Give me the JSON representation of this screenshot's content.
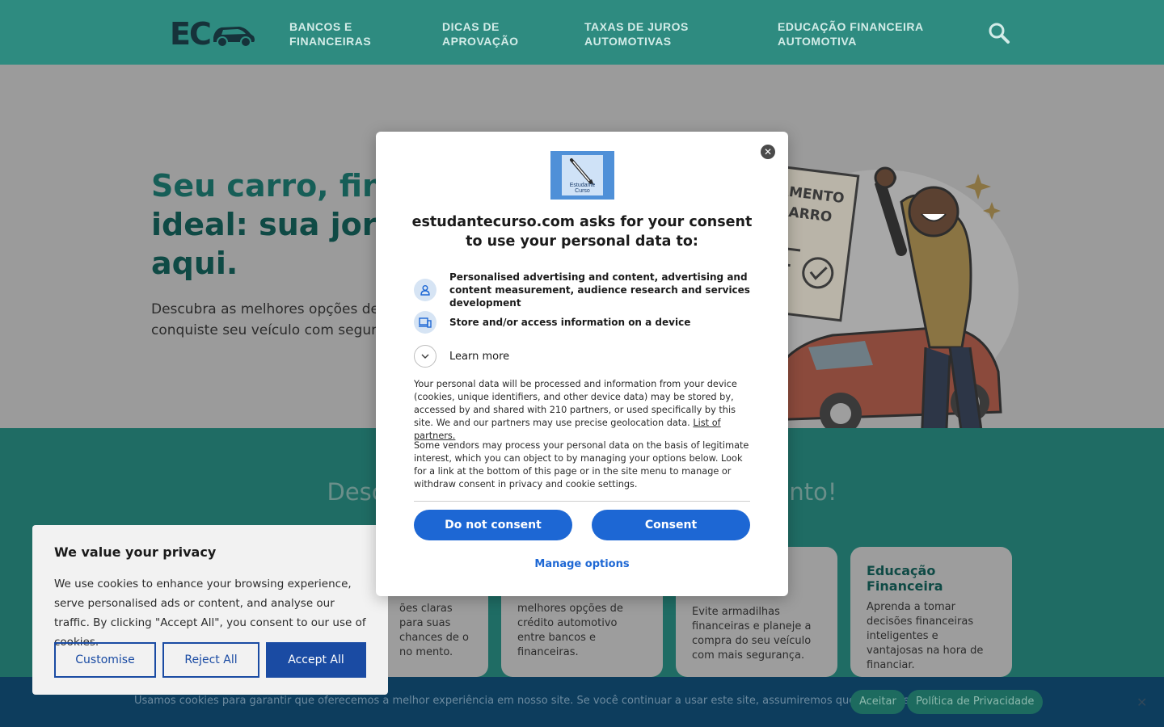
{
  "header": {
    "logo_text": "EC",
    "nav": [
      {
        "label": "BANCOS E FINANCEIRAS"
      },
      {
        "label": "DICAS DE APROVAÇÃO"
      },
      {
        "label": "TAXAS DE JUROS AUTOMOTIVAS"
      },
      {
        "label": "EDUCAÇÃO FINANCEIRA AUTOMOTIVA"
      }
    ]
  },
  "hero": {
    "title_line1": "Seu carro, financ",
    "title_line2": "ideal: sua jornad",
    "title_line3": "aqui.",
    "desc_line1": "Descubra as melhores opções de",
    "desc_line2": "conquiste seu veículo com segur",
    "illustration_text_line1": "NAMENTO",
    "illustration_text_line2": "ARRO"
  },
  "section": {
    "title_left": "Descub",
    "title_right": "amento!",
    "cards": [
      {
        "title": "",
        "text": "ões claras para suas chances de o no mento."
      },
      {
        "title": "",
        "text": "melhores opções de crédito automotivo entre bancos e financeiras."
      },
      {
        "title": "",
        "text": "Evite armadilhas financeiras e planeje a compra do seu veículo com mais segurança."
      },
      {
        "title": "Educação Financeira",
        "text": "Aprenda a tomar decisões financeiras inteligentes e vantajosas na hora de financiar."
      }
    ]
  },
  "bottom_bar": {
    "text": "Usamos cookies para garantir que oferecemos a melhor experiência em nosso site. Se você continuar a usar este site, assumiremos que está satisfeito com ele.",
    "accept_label": "Aceitar",
    "privacy_label": "Política de Privacidade",
    "close_glyph": "✕"
  },
  "privacy_box": {
    "title": "We value your privacy",
    "text": "We use cookies to enhance your browsing experience, serve personalised ads or content, and analyse our traffic. By clicking \"Accept All\", you consent to our use of cookies.",
    "customise_label": "Customise",
    "reject_label": "Reject All",
    "accept_label": "Accept All"
  },
  "consent_modal": {
    "logo_label": "Estudante Curso",
    "heading": "estudantecurso.com asks for your consent to use your personal data to:",
    "purposes": [
      {
        "icon": "person-icon",
        "text": "Personalised advertising and content, advertising and content measurement, audience research and services development"
      },
      {
        "icon": "devices-icon",
        "text": "Store and/or access information on a device"
      }
    ],
    "learn_more": "Learn more",
    "para1": "Your personal data will be processed and information from your device (cookies, unique identifiers, and other device data) may be stored by, accessed by and shared with 210 partners, or used specifically by this site. We and our partners may use precise geolocation data.",
    "partners_link": "List of partners.",
    "para2": "Some vendors may process your personal data on the basis of legitimate interest, which you can object to by managing your options below. Look for a link at the bottom of this page or in the site menu to manage or withdraw consent in privacy and cookie settings.",
    "do_not_consent": "Do not consent",
    "consent": "Consent",
    "manage_options": "Manage options",
    "close_glyph": "✕"
  }
}
